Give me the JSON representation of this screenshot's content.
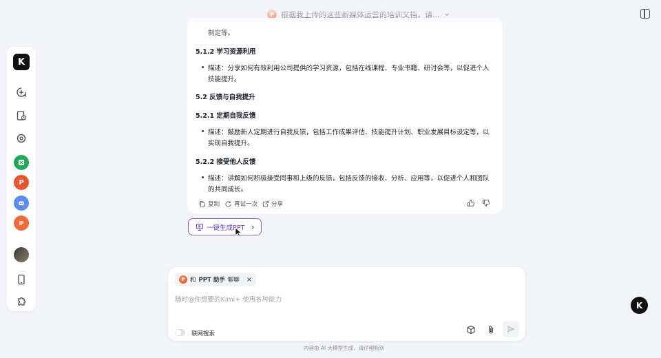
{
  "header": {
    "title": "根据我上传的这些新媒体运营的培训文档，请...",
    "ppt_badge": "P"
  },
  "sidebar": {
    "logo": "K",
    "items": [
      {
        "name": "new-chat-icon"
      },
      {
        "name": "history-icon"
      },
      {
        "name": "apps-icon"
      },
      {
        "name": "excel-app"
      },
      {
        "name": "ppt-app"
      },
      {
        "name": "bot-app"
      },
      {
        "name": "notes-app"
      },
      {
        "name": "user-avatar"
      },
      {
        "name": "mobile-icon"
      },
      {
        "name": "plugin-icon"
      }
    ]
  },
  "message": {
    "truncated_line": "制定等。",
    "s512_title": "5.1.2 学习资源利用",
    "s512_desc_1": "描述：分享如何有效利用公司提供的学习资源，包括在线课程、专业书籍、研讨会等，以促进个人",
    "s512_desc_2": "技能提升。",
    "s52_title": "5.2 反馈与自我提升",
    "s521_title": "5.2.1 定期自我反馈",
    "s521_desc_1": "描述：鼓励新人定期进行自我反馈，包括工作成果评估、技能提升计划、职业发展目标设定等，以",
    "s521_desc_2": "实现自我提升。",
    "s522_title": "5.2.2 接受他人反馈",
    "s522_desc_1": "描述：讲解如何积极接受同事和上级的反馈，包括反馈的接收、分析、应用等，以促进个人和团队",
    "s522_desc_2": "的共同成长。"
  },
  "actions": {
    "copy": "复制",
    "retry": "再试一次",
    "share": "分享"
  },
  "ppt_button": {
    "label": "一键生成PPT"
  },
  "input": {
    "chip_prefix": "和",
    "chip_name": "PPT 助手",
    "chip_suffix": "聊聊",
    "placeholder": "随时@你想要的Kimi+ 使用各种能力",
    "web_search": "联网搜索"
  },
  "footer": "内容由 AI 大模型生成，请仔细甄别",
  "colors": {
    "accent": "#6a3fd0",
    "background": "#f4f5f8"
  }
}
